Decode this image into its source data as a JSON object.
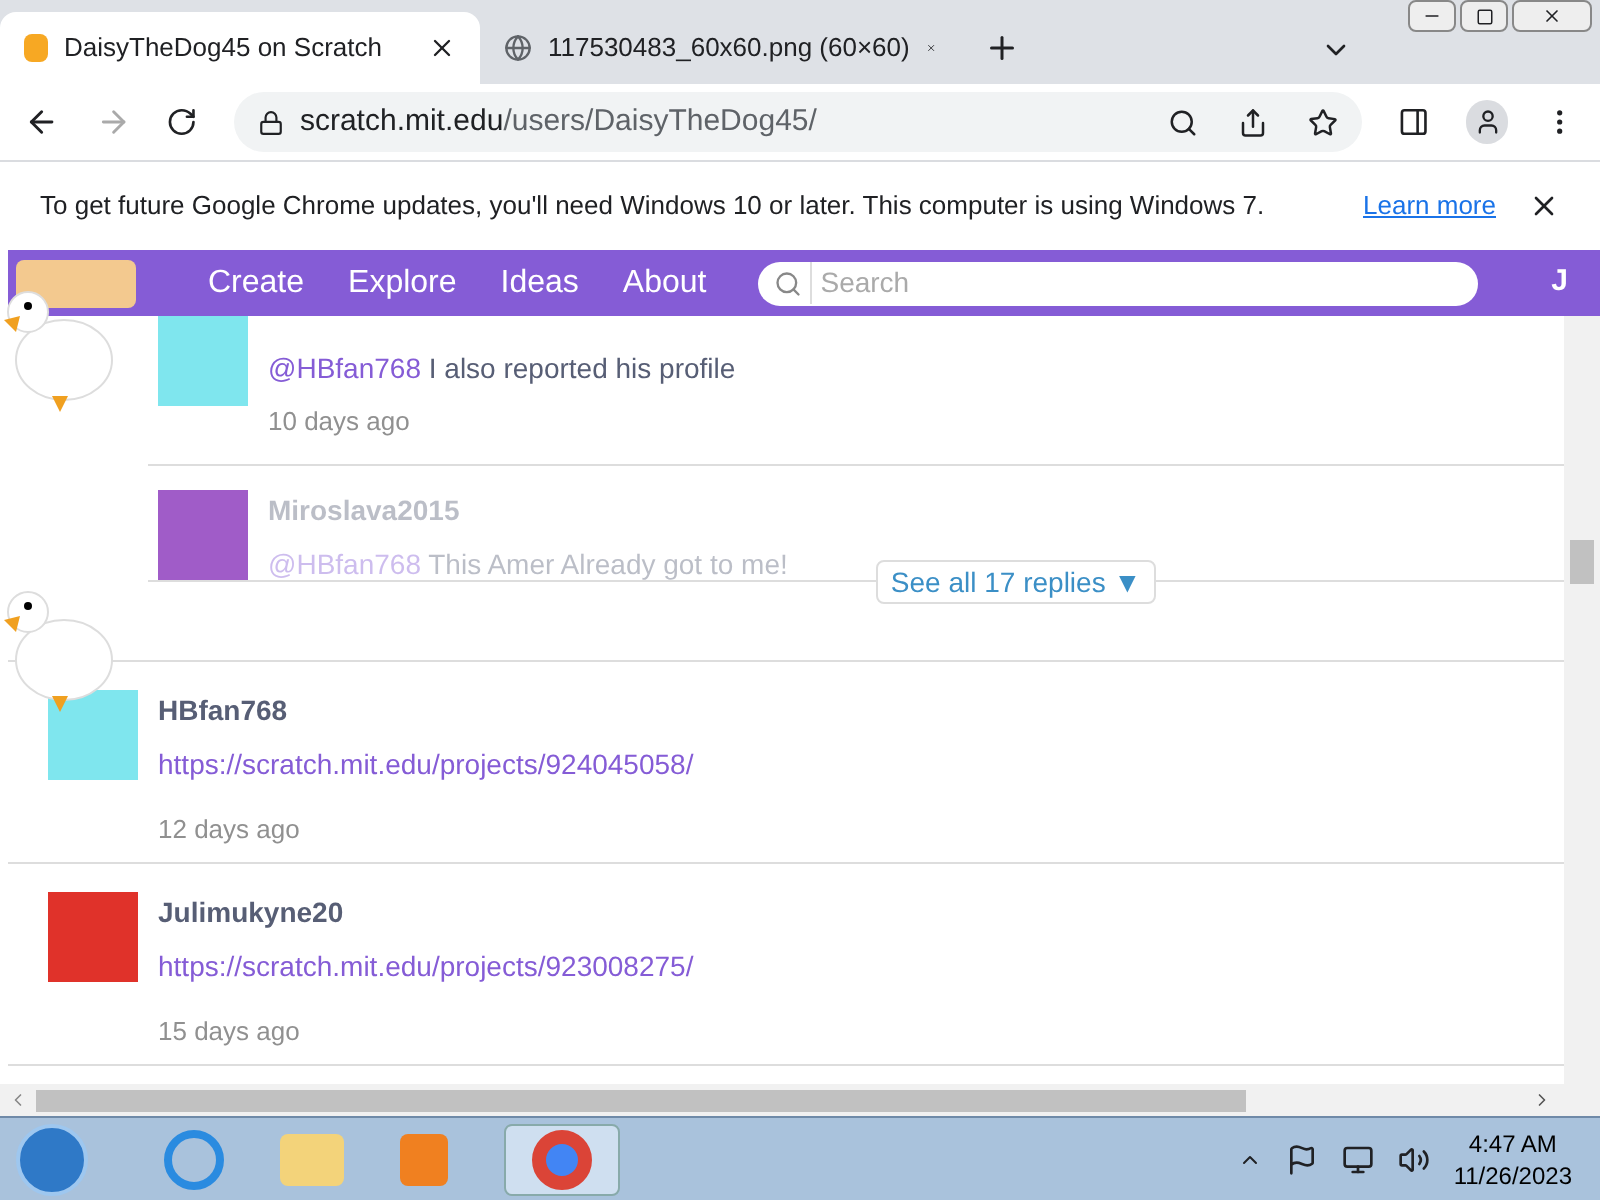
{
  "browser": {
    "tabs": [
      {
        "title": "DaisyTheDog45 on Scratch",
        "selected": true,
        "kind": "scratch"
      },
      {
        "title": "117530483_60x60.png (60×60)",
        "selected": false,
        "kind": "globe"
      }
    ],
    "address": {
      "host": "scratch.mit.edu",
      "path": "/users/DaisyTheDog45/"
    },
    "infobar": {
      "message": "To get future Google Chrome updates, you'll need Windows 10 or later. This computer is using Windows 7.",
      "link": "Learn more"
    }
  },
  "nav": {
    "items": [
      "Create",
      "Explore",
      "Ideas",
      "About"
    ],
    "search": {
      "placeholder": "Search"
    },
    "edge_text": "J"
  },
  "thread": {
    "replies": [
      {
        "mention": "@HBfan768",
        "text": "I also reported his profile",
        "time": "10 days ago",
        "color": "#7fe6ee",
        "faded": false
      },
      {
        "author": "Miroslava2015",
        "mention": "@HBfan768",
        "text": "This Amer Already got to me!",
        "color": "#a05cc8",
        "faded": true
      }
    ],
    "see_all": "See all 17 replies ▼"
  },
  "comments": [
    {
      "author": "HBfan768",
      "link": "https://scratch.mit.edu/projects/924045058/",
      "time": "12 days ago",
      "color": "#7fe6ee"
    },
    {
      "author": "Julimukyne20",
      "link": "https://scratch.mit.edu/projects/923008275/",
      "time": "15 days ago",
      "color": "#e0322a"
    }
  ],
  "taskbar": {
    "time": "4:47 AM",
    "date": "11/26/2023"
  }
}
